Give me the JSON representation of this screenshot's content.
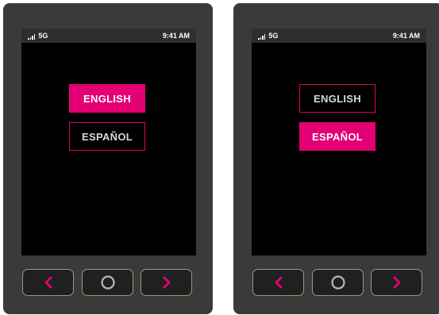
{
  "colors": {
    "accent": "#e20074",
    "device_body": "#3a3a3a",
    "screen": "#000000",
    "status_bar": "#2e2e2e",
    "nav_border": "#a09870"
  },
  "devices": [
    {
      "status": {
        "network": "5G",
        "time": "9:41 AM"
      },
      "languages": [
        {
          "label": "ENGLISH",
          "selected": true
        },
        {
          "label": "ESPAÑOL",
          "selected": false
        }
      ],
      "nav": {
        "back_icon": "chevron-left-icon",
        "home_icon": "home-circle-icon",
        "forward_icon": "chevron-right-icon"
      }
    },
    {
      "status": {
        "network": "5G",
        "time": "9:41 AM"
      },
      "languages": [
        {
          "label": "ENGLISH",
          "selected": false
        },
        {
          "label": "ESPAÑOL",
          "selected": true
        }
      ],
      "nav": {
        "back_icon": "chevron-left-icon",
        "home_icon": "home-circle-icon",
        "forward_icon": "chevron-right-icon"
      }
    }
  ]
}
